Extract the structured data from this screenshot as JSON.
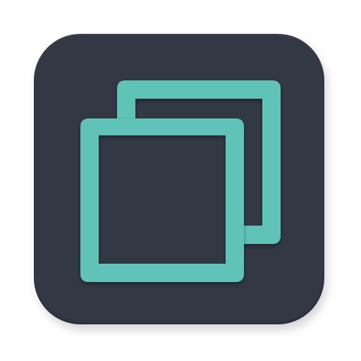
{
  "icon": {
    "name": "duplicate-copy-icon",
    "tile_color": "#333845",
    "accent_color": "#5FC4B7",
    "background": "#ffffff"
  }
}
